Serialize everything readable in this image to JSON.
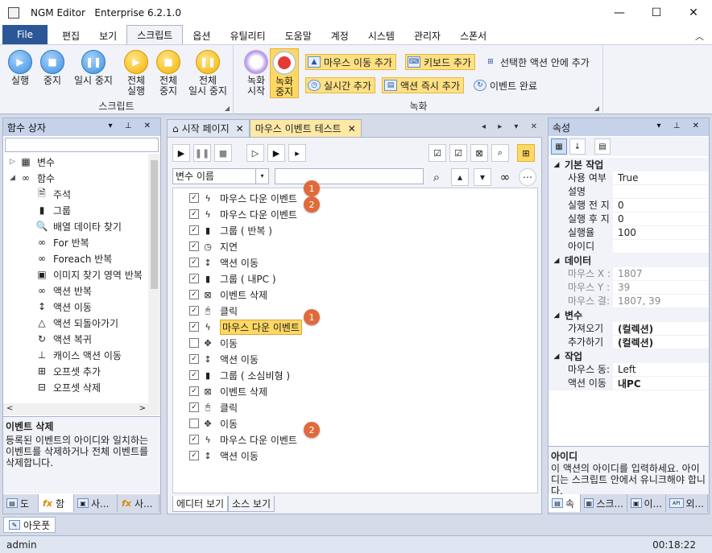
{
  "window": {
    "app_name": "NGM Editor",
    "edition": "Enterprise 6.2.1.0",
    "minimize_glyph": "—",
    "maximize_glyph": "☐",
    "close_glyph": "✕"
  },
  "menu": {
    "file": "File",
    "items": [
      "편집",
      "보기",
      "스크립트",
      "옵션",
      "유틸리티",
      "도움말",
      "계정",
      "시스템",
      "관리자",
      "스폰서"
    ],
    "active_index": 2,
    "collapse_glyph": "︿"
  },
  "ribbon": {
    "script_group": {
      "label": "스크립트",
      "buttons": [
        {
          "line1": "실행",
          "line2": "",
          "icon": "play-icon",
          "glyph": "▶"
        },
        {
          "line1": "중지",
          "line2": "",
          "icon": "stop-icon",
          "glyph": "■"
        },
        {
          "line1": "일시 중지",
          "line2": "",
          "icon": "pause-icon",
          "glyph": "❚❚"
        },
        {
          "line1": "전체",
          "line2": "실행",
          "icon": "play-all-icon",
          "glyph": "▶"
        },
        {
          "line1": "전체",
          "line2": "중지",
          "icon": "stop-all-icon",
          "glyph": "■"
        },
        {
          "line1": "전체",
          "line2": "일시 중지",
          "icon": "pause-all-icon",
          "glyph": "❚❚"
        }
      ]
    },
    "record_group": {
      "label": "녹화",
      "start": {
        "line1": "녹화",
        "line2": "시작"
      },
      "stop": {
        "line1": "녹화",
        "line2": "중지"
      },
      "small_buttons": {
        "add_mouse_move": "마우스 이동 추가",
        "add_keyboard": "키보드 추가",
        "add_inside_selected": "선택한 액션 안에 추가",
        "add_realtime": "실시간 추가",
        "add_action_now": "액션 즉시 추가",
        "event_complete": "이벤트 완료"
      }
    },
    "corner_glyph": "◢"
  },
  "left_panel": {
    "title": "함수 상자",
    "header_controls": "▾ ⊥ ✕",
    "tree": [
      {
        "label": "변수",
        "level": 0,
        "arrow": "▷",
        "icon": "variable-icon",
        "glyph": "▦"
      },
      {
        "label": "함수",
        "level": 0,
        "arrow": "◢",
        "icon": "function-icon",
        "glyph": "∞"
      },
      {
        "label": "주석",
        "level": 1,
        "icon": "comment-icon",
        "glyph": "🗎"
      },
      {
        "label": "그룹",
        "level": 1,
        "icon": "group-icon",
        "glyph": "▮"
      },
      {
        "label": "배열 데이타 찾기",
        "level": 1,
        "icon": "search-icon",
        "glyph": "🔍"
      },
      {
        "label": "For 반복",
        "level": 1,
        "icon": "loop-icon",
        "glyph": "∞"
      },
      {
        "label": "Foreach 반복",
        "level": 1,
        "icon": "foreach-icon",
        "glyph": "∞"
      },
      {
        "label": "이미지 찾기 영역 반복",
        "level": 1,
        "icon": "image-loop-icon",
        "glyph": "▣"
      },
      {
        "label": "액션 반복",
        "level": 1,
        "icon": "action-repeat-icon",
        "glyph": "∞"
      },
      {
        "label": "액션 이동",
        "level": 1,
        "icon": "action-move-icon",
        "glyph": "↕"
      },
      {
        "label": "액션 되돌아가기",
        "level": 1,
        "icon": "action-return-icon",
        "glyph": "△"
      },
      {
        "label": "액션 복귀",
        "level": 1,
        "icon": "action-restore-icon",
        "glyph": "↻"
      },
      {
        "label": "캐이스 액션 이동",
        "level": 1,
        "icon": "case-move-icon",
        "glyph": "⊥"
      },
      {
        "label": "오프셋 추가",
        "level": 1,
        "icon": "offset-add-icon",
        "glyph": "⊞"
      },
      {
        "label": "오프셋 삭제",
        "level": 1,
        "icon": "offset-delete-icon",
        "glyph": "⊟"
      }
    ],
    "scroll_left": "<",
    "scroll_right": ">",
    "desc_title": "이벤트 삭제",
    "desc_text": "등록된 이벤트의 아이디와 일치하는 이벤트를 삭제하거나 전체 이벤트를 삭제합니다.",
    "tabs": [
      {
        "label": "도",
        "icon": "doc-icon",
        "glyph": "▤"
      },
      {
        "label": "함",
        "icon": "fx-icon",
        "glyph": "fx"
      },
      {
        "label": "사...",
        "icon": "briefcase-icon",
        "glyph": "▣"
      },
      {
        "label": "사...",
        "icon": "fx2-icon",
        "glyph": "fx"
      }
    ]
  },
  "center": {
    "tabs": [
      {
        "label": "시작 페이지",
        "close": "✕"
      },
      {
        "label": "마우스 이벤트 테스트",
        "close": "✕"
      }
    ],
    "tab_controls": "◂ ▸ ▾ ✕",
    "toolbar_glyphs": {
      "play": "▶",
      "pause": "❚❚",
      "stop": "■",
      "play_outline": "▷",
      "play_boxed": "▶",
      "step": "▸",
      "check_all": "☑",
      "check_partial": "☑",
      "clear": "⊠",
      "zoom": "⌕",
      "tree": "⊞"
    },
    "filter": {
      "field": "변수 이름",
      "dropdown_glyph": "▾",
      "search_glyph": "⌕",
      "up_glyph": "▴",
      "down_glyph": "▾",
      "loop_glyph": "∞",
      "more_glyph": "⋯"
    },
    "events": [
      {
        "label": "마우스 다운 이벤트",
        "checked": true,
        "icon": "lightning-icon",
        "glyph": "ϟ"
      },
      {
        "label": "마우스 다운 이벤트",
        "checked": true,
        "icon": "lightning-icon",
        "glyph": "ϟ"
      },
      {
        "label": "그룹 ( 반복 )",
        "checked": true,
        "icon": "group-icon",
        "glyph": "▮"
      },
      {
        "label": "지연",
        "checked": true,
        "icon": "timer-icon",
        "glyph": "◷"
      },
      {
        "label": "액션 이동",
        "checked": true,
        "icon": "action-move-icon",
        "glyph": "↕"
      },
      {
        "label": "그룹 ( 내PC )",
        "checked": true,
        "icon": "group-icon",
        "glyph": "▮"
      },
      {
        "label": "이벤트 삭제",
        "checked": true,
        "icon": "delete-event-icon",
        "glyph": "⊠"
      },
      {
        "label": "클릭",
        "checked": true,
        "icon": "mouse-icon",
        "glyph": "🖰"
      },
      {
        "label": "마우스 다운 이벤트",
        "checked": true,
        "icon": "lightning-icon",
        "glyph": "ϟ",
        "selected": true
      },
      {
        "label": "이동",
        "checked": false,
        "icon": "move-icon",
        "glyph": "✥"
      },
      {
        "label": "액션 이동",
        "checked": true,
        "icon": "action-move-icon",
        "glyph": "↕"
      },
      {
        "label": "그룹 ( 소심비형 )",
        "checked": true,
        "icon": "group-icon",
        "glyph": "▮"
      },
      {
        "label": "이벤트 삭제",
        "checked": true,
        "icon": "delete-event-icon",
        "glyph": "⊠"
      },
      {
        "label": "클릭",
        "checked": true,
        "icon": "mouse-icon",
        "glyph": "🖰"
      },
      {
        "label": "이동",
        "checked": false,
        "icon": "move-icon",
        "glyph": "✥"
      },
      {
        "label": "마우스 다운 이벤트",
        "checked": true,
        "icon": "lightning-icon",
        "glyph": "ϟ"
      },
      {
        "label": "액션 이동",
        "checked": true,
        "icon": "action-move-icon",
        "glyph": "↕"
      }
    ],
    "check_glyph": "✓",
    "badges": [
      {
        "text": "1",
        "row": 0
      },
      {
        "text": "2",
        "row": 1
      },
      {
        "text": "1",
        "row": 8
      },
      {
        "text": "2",
        "row": 15
      }
    ],
    "badge_color": "#e06a3c",
    "bottom_tabs": [
      "에디터 보기",
      "소스 보기"
    ]
  },
  "right_panel": {
    "title": "속성",
    "header_controls": "▾ ⊥ ✕",
    "toolbar_glyphs": [
      "▦",
      "↓",
      "▤"
    ],
    "categories": [
      {
        "name": "기본 작업",
        "arrow": "◢",
        "rows": [
          {
            "name": "사용 여부",
            "value": "True"
          },
          {
            "name": "설명",
            "value": ""
          },
          {
            "name": "실행 전 지",
            "value": "0"
          },
          {
            "name": "실행 후 지",
            "value": "0"
          },
          {
            "name": "실행율",
            "value": "100"
          },
          {
            "name": "아이디",
            "value": ""
          }
        ]
      },
      {
        "name": "데이터",
        "arrow": "◢",
        "rows": [
          {
            "name": "마우스 X :",
            "value": "1807",
            "disabled": true
          },
          {
            "name": "마우스 Y :",
            "value": "39",
            "disabled": true
          },
          {
            "name": "마우스 결:",
            "value": "1807, 39",
            "disabled": true,
            "arrow": ">"
          }
        ]
      },
      {
        "name": "변수",
        "arrow": "◢",
        "rows": [
          {
            "name": "가져오기",
            "value": "(컬렉션)",
            "bold": true
          },
          {
            "name": "추가하기",
            "value": "(컬렉션)",
            "bold": true
          }
        ]
      },
      {
        "name": "작업",
        "arrow": "◢",
        "rows": [
          {
            "name": "마우스 동:",
            "value": "Left"
          },
          {
            "name": "액션 이동",
            "value": "내PC",
            "bold": true
          }
        ]
      }
    ],
    "desc_title": "아이디",
    "desc_text": "이 액션의 아이디를 입력하세요. 아이디는 스크립트 안에서 유니크해야 합니다.",
    "tabs": [
      {
        "label": "속",
        "glyph": "▤"
      },
      {
        "label": "스크...",
        "glyph": "▦"
      },
      {
        "label": "이...",
        "glyph": "▣"
      },
      {
        "label": "외...",
        "glyph": "API"
      }
    ]
  },
  "bottom": {
    "output_tab": "아웃풋",
    "output_glyph": "✎",
    "user": "admin",
    "time": "00:18:22"
  }
}
